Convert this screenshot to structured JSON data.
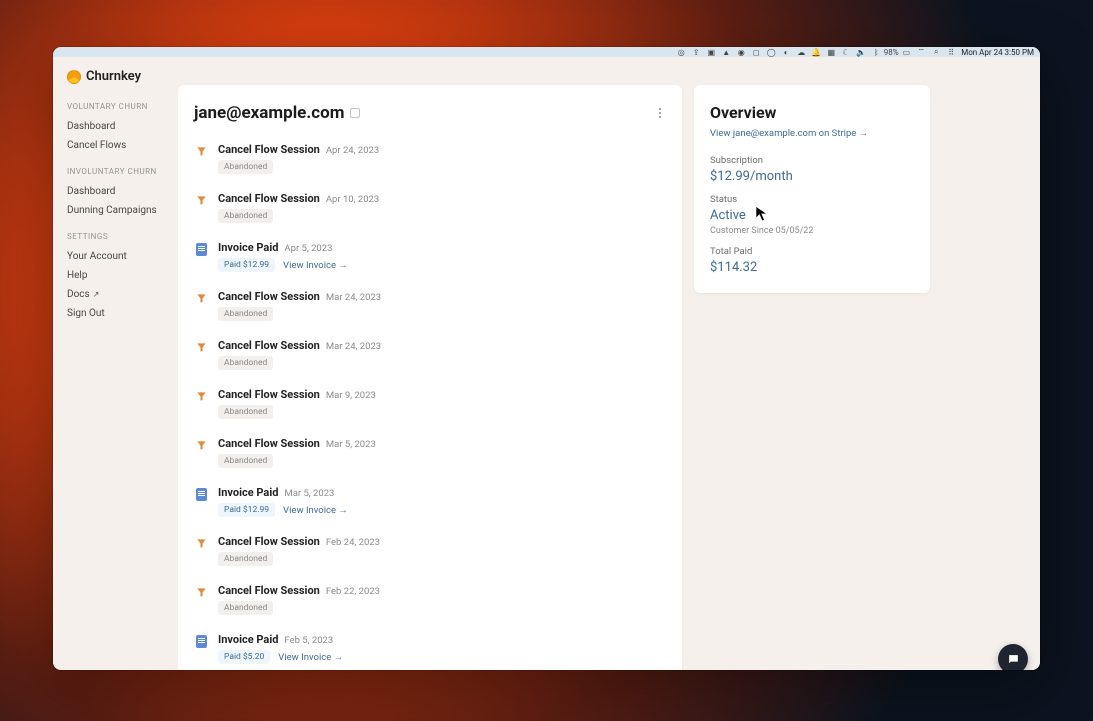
{
  "menubar": {
    "battery_pct": "98%",
    "clock": "Mon Apr 24  3:50 PM"
  },
  "brand": {
    "name": "Churnkey"
  },
  "sidebar": {
    "sections": [
      {
        "label": "VOLUNTARY CHURN",
        "items": [
          {
            "label": "Dashboard"
          },
          {
            "label": "Cancel Flows"
          }
        ]
      },
      {
        "label": "INVOLUNTARY CHURN",
        "items": [
          {
            "label": "Dashboard"
          },
          {
            "label": "Dunning Campaigns"
          }
        ]
      },
      {
        "label": "SETTINGS",
        "items": [
          {
            "label": "Your Account"
          },
          {
            "label": "Help"
          },
          {
            "label": "Docs",
            "external": true
          },
          {
            "label": "Sign Out"
          }
        ]
      }
    ]
  },
  "customer": {
    "email": "jane@example.com"
  },
  "events": [
    {
      "type": "cancel",
      "title": "Cancel Flow Session",
      "date": "Apr 24, 2023",
      "tag": "Abandoned"
    },
    {
      "type": "cancel",
      "title": "Cancel Flow Session",
      "date": "Apr 10, 2023",
      "tag": "Abandoned"
    },
    {
      "type": "invoice",
      "title": "Invoice Paid",
      "date": "Apr 5, 2023",
      "paid_tag": "Paid $12.99",
      "link": "View Invoice →"
    },
    {
      "type": "cancel",
      "title": "Cancel Flow Session",
      "date": "Mar 24, 2023",
      "tag": "Abandoned"
    },
    {
      "type": "cancel",
      "title": "Cancel Flow Session",
      "date": "Mar 24, 2023",
      "tag": "Abandoned"
    },
    {
      "type": "cancel",
      "title": "Cancel Flow Session",
      "date": "Mar 9, 2023",
      "tag": "Abandoned"
    },
    {
      "type": "cancel",
      "title": "Cancel Flow Session",
      "date": "Mar 5, 2023",
      "tag": "Abandoned"
    },
    {
      "type": "invoice",
      "title": "Invoice Paid",
      "date": "Mar 5, 2023",
      "paid_tag": "Paid $12.99",
      "link": "View Invoice →"
    },
    {
      "type": "cancel",
      "title": "Cancel Flow Session",
      "date": "Feb 24, 2023",
      "tag": "Abandoned"
    },
    {
      "type": "cancel",
      "title": "Cancel Flow Session",
      "date": "Feb 22, 2023",
      "tag": "Abandoned"
    },
    {
      "type": "invoice",
      "title": "Invoice Paid",
      "date": "Feb 5, 2023",
      "paid_tag": "Paid $5.20",
      "link": "View Invoice →"
    }
  ],
  "overview": {
    "title": "Overview",
    "stripe_link": "View jane@example.com on Stripe →",
    "subscription_label": "Subscription",
    "subscription_value": "$12.99/month",
    "status_label": "Status",
    "status_value": "Active",
    "customer_since": "Customer Since 05/05/22",
    "total_paid_label": "Total Paid",
    "total_paid_value": "$114.32"
  }
}
